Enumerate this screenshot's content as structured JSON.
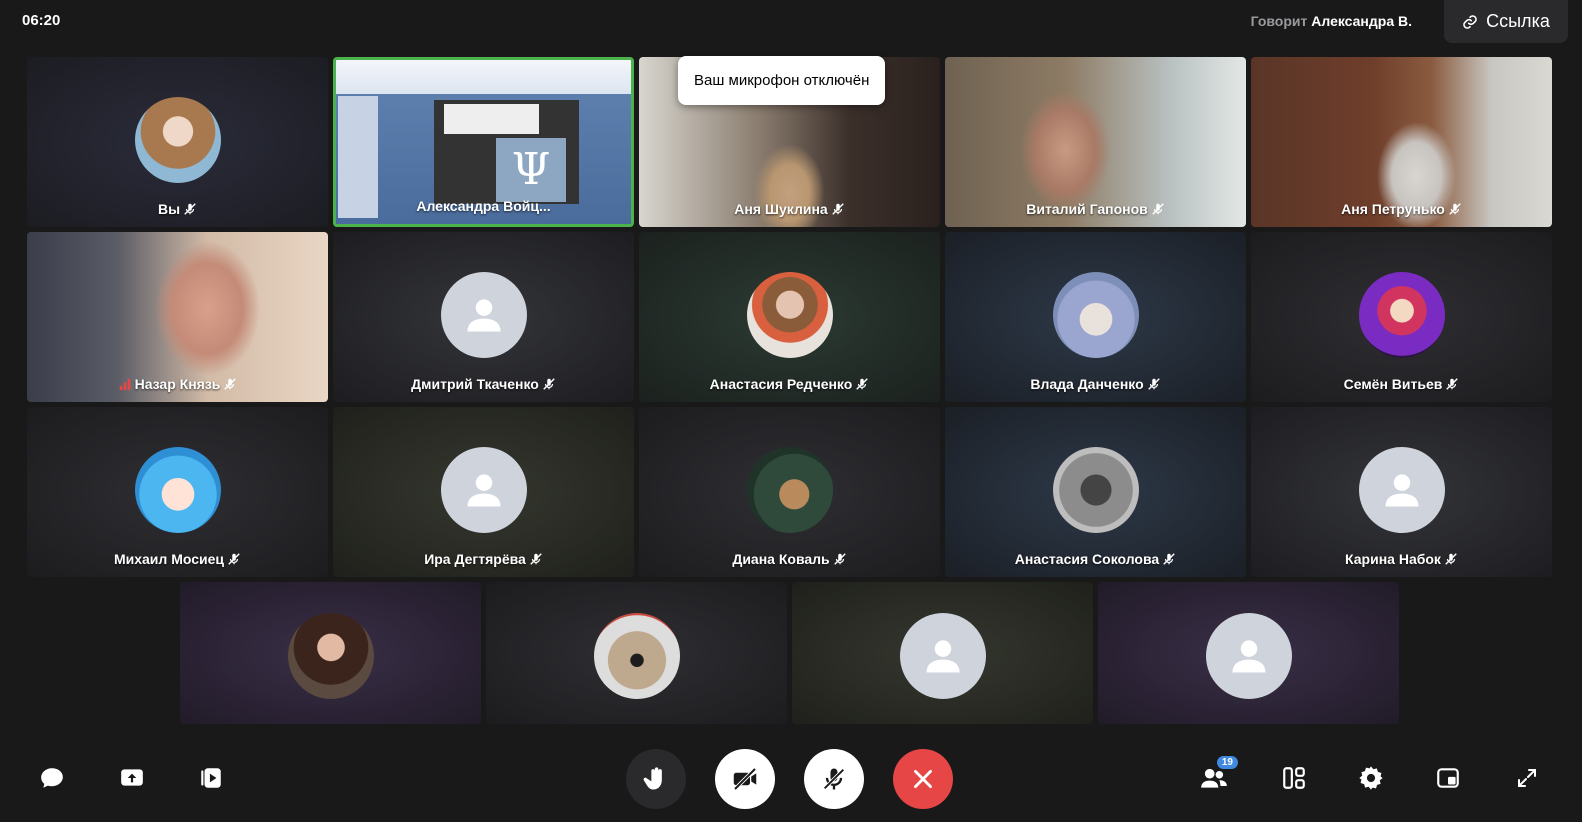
{
  "header": {
    "timer": "06:20",
    "speaking_prefix": "Говорит",
    "speaking_name": "Александра В.",
    "link_label": "Ссылка"
  },
  "toast": {
    "text": "Ваш микрофон отключён"
  },
  "participants": [
    {
      "name": "Вы"
    },
    {
      "name": "Александра Войц..."
    },
    {
      "name": "Аня Шуклина"
    },
    {
      "name": "Виталий Гапонов"
    },
    {
      "name": "Аня Петрунько"
    },
    {
      "name": "Назар Князь"
    },
    {
      "name": "Дмитрий Ткаченко"
    },
    {
      "name": "Анастасия Редченко"
    },
    {
      "name": "Влада Данченко"
    },
    {
      "name": "Семён Витьев"
    },
    {
      "name": "Михаил Мосиец"
    },
    {
      "name": "Ира Дегтярёва"
    },
    {
      "name": "Диана Коваль"
    },
    {
      "name": "Анастасия Соколова"
    },
    {
      "name": "Карина Набок"
    }
  ],
  "footer": {
    "participants_count": "19"
  },
  "colors": {
    "background": "#19191a",
    "active_speaker": "#4bb34b",
    "end_call": "#e64646",
    "badge": "#3f8ae0"
  }
}
